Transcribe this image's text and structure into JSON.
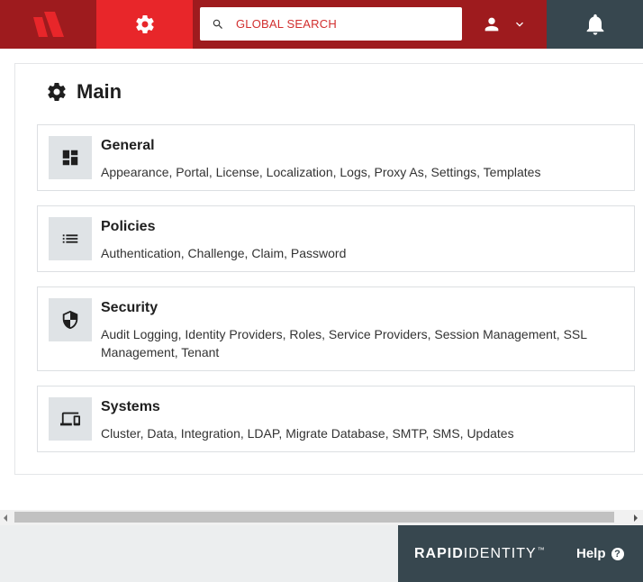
{
  "header": {
    "logo_icon": "rapididentity-logo-icon",
    "settings_icon": "gear-icon",
    "search": {
      "placeholder": "GLOBAL SEARCH",
      "value": ""
    },
    "user_icon": "person-icon",
    "bell_icon": "bell-icon"
  },
  "main": {
    "title": "Main",
    "title_icon": "gear-icon",
    "cards": [
      {
        "title": "General",
        "desc": "Appearance, Portal, License, Localization, Logs, Proxy As, Settings, Templates",
        "icon": "dashboard-icon"
      },
      {
        "title": "Policies",
        "desc": "Authentication, Challenge, Claim, Password",
        "icon": "list-icon"
      },
      {
        "title": "Security",
        "desc": "Audit Logging, Identity Providers, Roles, Service Providers, Session Management, SSL Management, Tenant",
        "icon": "shield-icon"
      },
      {
        "title": "Systems",
        "desc": "Cluster, Data, Integration, LDAP, Migrate Database, SMTP, SMS, Updates",
        "icon": "devices-icon"
      }
    ]
  },
  "footer": {
    "brand_bold": "RAPID",
    "brand_light": "IDENTITY",
    "brand_tm": "™",
    "help_label": "Help",
    "help_icon_glyph": "?"
  },
  "colors": {
    "brand_dark_red": "#9e1b1e",
    "brand_red": "#e8262a",
    "slate": "#37474f",
    "search_text": "#d22f2f"
  }
}
